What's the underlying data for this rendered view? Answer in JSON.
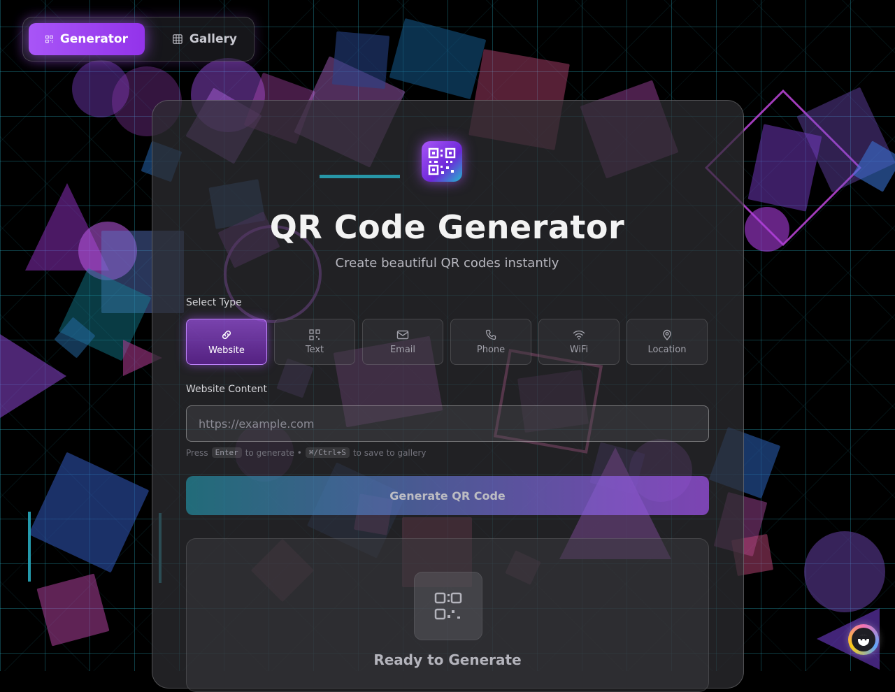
{
  "nav": {
    "tabs": [
      {
        "label": "Generator",
        "icon": "qr-code-icon",
        "active": true
      },
      {
        "label": "Gallery",
        "icon": "grid-icon",
        "active": false
      }
    ]
  },
  "header": {
    "title": "QR Code Generator",
    "subtitle": "Create beautiful QR codes instantly"
  },
  "form": {
    "select_type_label": "Select Type",
    "types": [
      {
        "label": "Website",
        "icon": "link-icon",
        "active": true
      },
      {
        "label": "Text",
        "icon": "qr-small-icon",
        "active": false
      },
      {
        "label": "Email",
        "icon": "mail-icon",
        "active": false
      },
      {
        "label": "Phone",
        "icon": "phone-icon",
        "active": false
      },
      {
        "label": "WiFi",
        "icon": "wifi-icon",
        "active": false
      },
      {
        "label": "Location",
        "icon": "map-pin-icon",
        "active": false
      }
    ],
    "content_label": "Website Content",
    "input_placeholder": "https://example.com",
    "input_value": "",
    "hint": {
      "press": "Press",
      "key_enter": "Enter",
      "to_generate": "to generate •",
      "key_save": "⌘/Ctrl+S",
      "to_save": "to save to gallery"
    },
    "generate_label": "Generate QR Code"
  },
  "preview": {
    "title": "Ready to Generate"
  },
  "colors": {
    "accent": "#a855f7",
    "accent_dark": "#9333ea",
    "cyan": "#22b8cf",
    "background": "#000000"
  }
}
